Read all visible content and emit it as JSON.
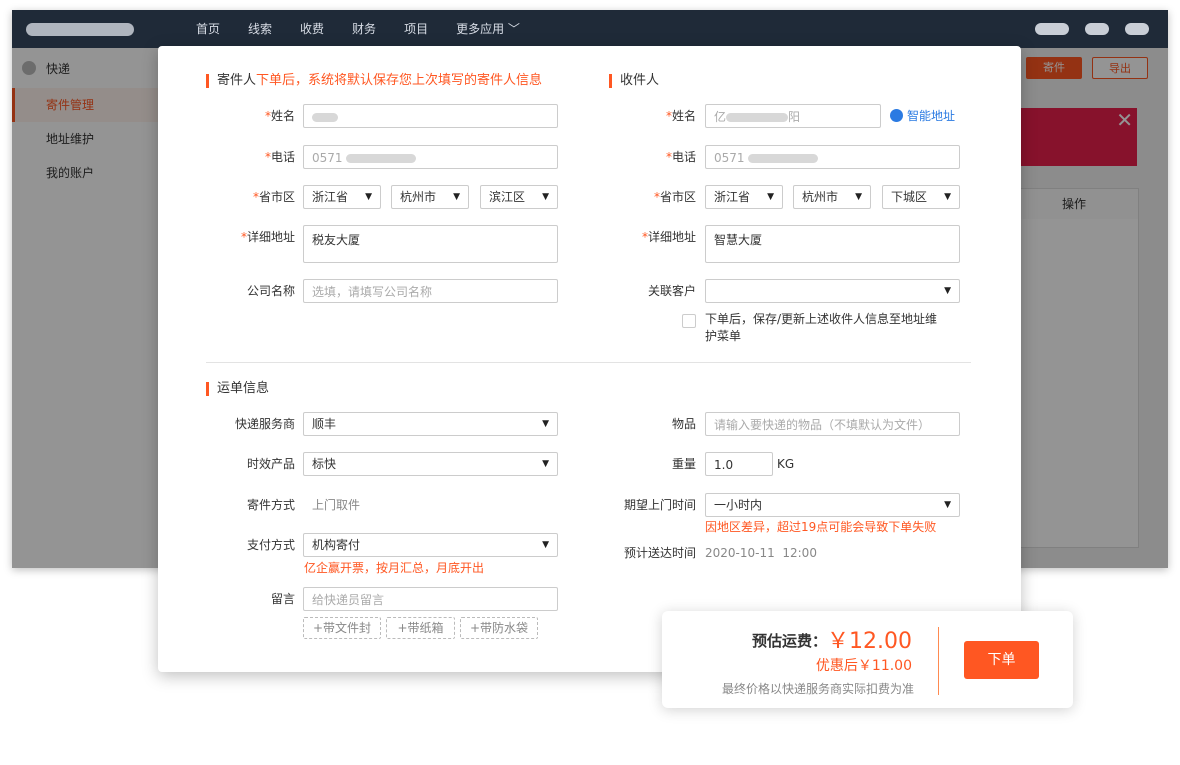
{
  "nav": [
    "首页",
    "线索",
    "收费",
    "财务",
    "项目",
    "更多应用"
  ],
  "sidebar": {
    "header": "快递",
    "items": [
      "寄件管理",
      "地址维护",
      "我的账户"
    ]
  },
  "toolbar": {
    "send": "寄件",
    "export": "导出"
  },
  "table": {
    "op_header": "操作"
  },
  "sender": {
    "title": "寄件人",
    "hint": "下单后，系统将默认保存您上次填写的寄件人信息",
    "name_label": "姓名",
    "phone_label": "电话",
    "region_label": "省市区",
    "address_label": "详细地址",
    "company_label": "公司名称",
    "phone_prefix": "0571",
    "province": "浙江省",
    "city": "杭州市",
    "district": "滨江区",
    "address": "税友大厦",
    "company_placeholder": "选填，请填写公司名称"
  },
  "receiver": {
    "title": "收件人",
    "name_label": "姓名",
    "phone_label": "电话",
    "region_label": "省市区",
    "address_label": "详细地址",
    "customer_label": "关联客户",
    "name_prefix": "亿",
    "name_suffix": "阳",
    "phone_prefix": "0571",
    "smart_address": "智能地址",
    "province": "浙江省",
    "city": "杭州市",
    "district": "下城区",
    "address": "智慧大厦",
    "save_checkbox_text_1": "下单后，保存/更新上述收件人信息至地址维",
    "save_checkbox_text_2": "护菜单"
  },
  "waybill": {
    "title": "运单信息",
    "courier_label": "快递服务商",
    "courier": "顺丰",
    "product_label": "时效产品",
    "product": "标快",
    "method_label": "寄件方式",
    "method": "上门取件",
    "payment_label": "支付方式",
    "payment": "机构寄付",
    "payment_note": "亿企赢开票，按月汇总，月底开出",
    "message_label": "留言",
    "message_placeholder": "给快递员留言",
    "tags": [
      "+带文件封",
      "+带纸箱",
      "+带防水袋"
    ],
    "item_label": "物品",
    "item_placeholder": "请输入要快递的物品（不填默认为文件）",
    "weight_label": "重量",
    "weight": "1.0",
    "weight_unit": "KG",
    "pickup_label": "期望上门时间",
    "pickup": "一小时内",
    "pickup_warning": "因地区差异，超过19点可能会导致下单失败",
    "eta_label": "预计送达时间",
    "eta": "2020-10-11  12:00"
  },
  "price": {
    "label": "预估运费：",
    "amount": "￥12.00",
    "discount": "优惠后￥11.00",
    "note": "最终价格以快递服务商实际扣费为准",
    "order_button": "下单"
  }
}
